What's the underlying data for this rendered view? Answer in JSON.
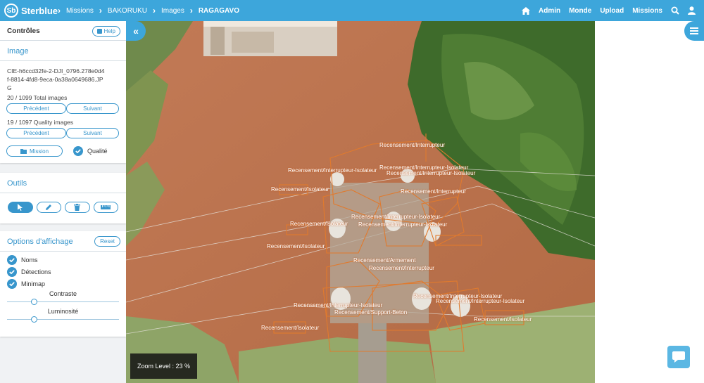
{
  "app": {
    "brand": "Sterblue",
    "logo_letters": "Sb"
  },
  "breadcrumbs": [
    "Missions",
    "BAKORUKU",
    "Images",
    "RAGAGAVO"
  ],
  "nav": {
    "admin": "Admin",
    "monde": "Monde",
    "upload": "Upload",
    "missions": "Missions"
  },
  "sidebar": {
    "controls_title": "Contrôles",
    "help_label": "Help",
    "image_section": {
      "title": "Image",
      "filename": "CIE-h6ccd32fe-2-DJI_0796.278e0d4f-8814-4fd8-9eca-0a38a0649686.JPG",
      "total_images": "20 / 1099 Total images",
      "quality_images": "19 / 1097 Quality images",
      "prev_label": "Précédent",
      "next_label": "Suivant",
      "prev_quality_label": "Précédent",
      "next_quality_label": "Suivant",
      "mission_label": "Mission",
      "quality_label": "Qualité"
    },
    "tools_section": {
      "title": "Outils"
    },
    "display_section": {
      "title": "Options d'affichage",
      "reset_label": "Reset",
      "noms_label": "Noms",
      "detections_label": "Détections",
      "minimap_label": "Minimap",
      "contrast_label": "Contraste",
      "brightness_label": "Luminosité",
      "contrast_value": 0.24,
      "brightness_value": 0.24
    }
  },
  "viewer": {
    "zoom_text": "Zoom Level : 23 %",
    "labels": [
      "Recensement/Interrupteur",
      "Recensement/Interrupteur-Isolateur",
      "Recensement/Interrupteur-Isolateur",
      "Recensement/Interrupteur-Isolateur",
      "Recensement/Isolateur",
      "Recensement/Interrupteur",
      "Recensement/Interrupteur-Isolateur",
      "Recensement/Interrupteur-Isolateur",
      "Recensement/Isolateur",
      "Recensement/Isolateur",
      "Recensement/Armement",
      "Recensement/Interrupteur",
      "Recensement/Interrupteur-Isolateur",
      "Recensement/Interrupteur-Isolateur",
      "Recensement/Interrupteur-Isolateur",
      "Recensement/Support-Beton",
      "Recensement/Isolateur",
      "Recensement/Isolateur"
    ]
  },
  "colors": {
    "brand": "#3da6db",
    "accent": "#3896cc",
    "detection": "#e07a2e"
  }
}
